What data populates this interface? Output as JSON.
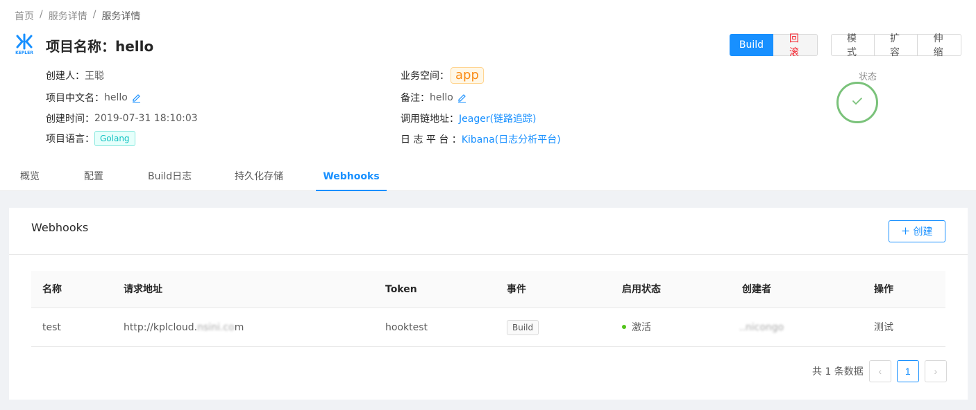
{
  "breadcrumb": {
    "home": "首页",
    "services": "服务详情",
    "current": "服务详情",
    "sep": "/"
  },
  "header": {
    "title": "项目名称：hello",
    "logo_text": "KEPLER"
  },
  "actions": {
    "build": "Build",
    "rollback": "回滚",
    "mode": "模式",
    "scale": "扩容",
    "stretch": "伸缩"
  },
  "info": {
    "creator_label": "创建人：",
    "creator": "王聪",
    "cn_name_label": "项目中文名：",
    "cn_name": "hello",
    "created_label": "创建时间：",
    "created": "2019-07-31 18:10:03",
    "lang_label": "项目语言：",
    "lang": "Golang",
    "space_label": "业务空间：",
    "space": "app",
    "note_label": "备注：",
    "note": "hello",
    "trace_label": "调用链地址：",
    "trace": "Jeager(链路追踪)",
    "log_label": "日 志 平 台 ：",
    "log": "Kibana(日志分析平台)"
  },
  "status": {
    "label": "状态",
    "value_icon": "check-icon",
    "color": "#7ac27a"
  },
  "tabs": [
    "概览",
    "配置",
    "Build日志",
    "持久化存储",
    "Webhooks"
  ],
  "active_tab": "Webhooks",
  "webhooks": {
    "title": "Webhooks",
    "create": "创建",
    "columns": [
      "名称",
      "请求地址",
      "Token",
      "事件",
      "启用状态",
      "创建者",
      "操作"
    ],
    "rows": [
      {
        "name": "test",
        "url": "http://kplcloud.",
        "url_hidden": "nsini.co",
        "url_tail": "m",
        "token": "hooktest",
        "event": "Build",
        "status": "激活",
        "creator": "..nicongo",
        "action": "测试"
      }
    ],
    "pagination": {
      "total": "共 1 条数据",
      "page": "1",
      "prev": "‹",
      "next": "›"
    }
  },
  "colors": {
    "primary": "#1890ff",
    "danger": "#f5222d",
    "success": "#52c41a",
    "app_tag": "#fa8c16",
    "golang_tag": "#13c2c2"
  }
}
